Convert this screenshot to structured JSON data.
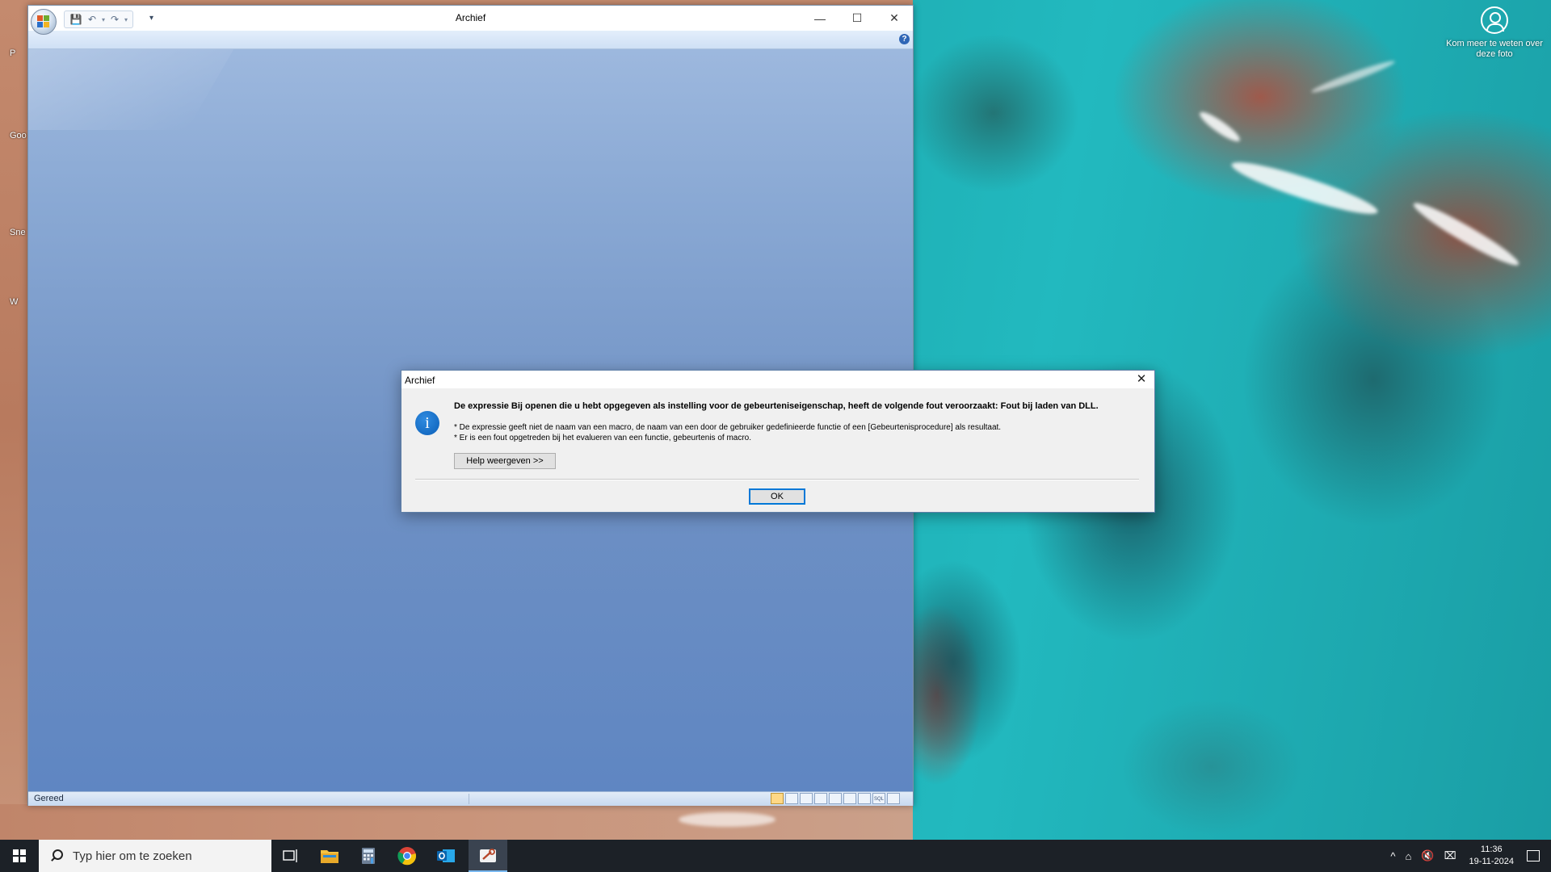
{
  "desktop": {
    "spotlight_label": "Kom meer te weten over deze foto",
    "icon_stubs": [
      "P",
      "Goo",
      "Sne",
      "W"
    ]
  },
  "window": {
    "title": "Archief",
    "minimize_symbol": "—",
    "maximize_symbol": "☐",
    "close_symbol": "✕",
    "qat": {
      "save_icon": "💾",
      "undo_icon": "↶",
      "redo_icon": "↷",
      "dropdown_icon": "▾",
      "customize_icon": "▾"
    },
    "help_symbol": "?",
    "statusbar": {
      "status": "Gereed",
      "view_buttons": [
        "",
        "",
        "",
        "",
        "",
        "",
        "",
        "SQL",
        ""
      ]
    }
  },
  "dialog": {
    "title": "Archief",
    "close_symbol": "✕",
    "icon_symbol": "i",
    "main_message": "De expressie Bij openen die u hebt opgegeven als instelling voor de gebeurteniseigenschap, heeft de volgende fout veroorzaakt: Fout bij laden van DLL.",
    "detail_line1": "* De expressie geeft niet de naam van een macro, de naam van een door de gebruiker gedefinieerde functie of een [Gebeurtenisprocedure] als resultaat.",
    "detail_line2": "* Er is een fout opgetreden bij het evalueren van een functie, gebeurtenis of macro.",
    "help_button": "Help weergeven >>",
    "ok_button": "OK"
  },
  "taskbar": {
    "search_placeholder": "Typ hier om te zoeken",
    "clock_time": "11:36",
    "clock_date": "19-11-2024",
    "tray_icons": [
      "^",
      "⌂",
      "🔇",
      "⌧"
    ]
  }
}
